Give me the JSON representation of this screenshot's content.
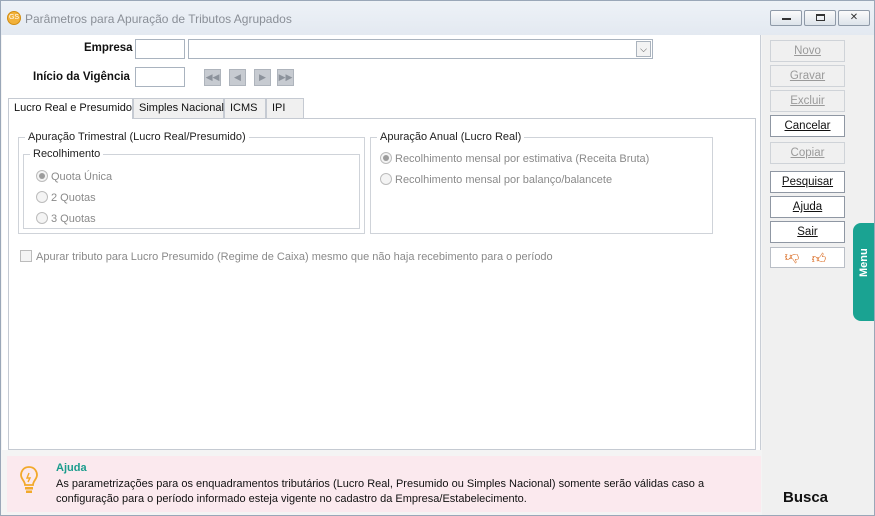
{
  "window": {
    "title": "Parâmetros para Apuração de Tributos Agrupados",
    "app_icon_text": "GS"
  },
  "form": {
    "empresa_label": "Empresa",
    "empresa_code": "",
    "empresa_name": "",
    "vigencia_label": "Início da Vigência",
    "vigencia_value": ""
  },
  "tabs": [
    {
      "label": "Lucro Real e Presumido",
      "active": true
    },
    {
      "label": "Simples Nacional",
      "active": false
    },
    {
      "label": "ICMS",
      "active": false
    },
    {
      "label": "IPI",
      "active": false
    }
  ],
  "trimestral": {
    "legend": "Apuração Trimestral (Lucro Real/Presumido)",
    "recolhimento_legend": "Recolhimento",
    "options": [
      "Quota Única",
      "2 Quotas",
      "3 Quotas"
    ],
    "selected": "Quota Única"
  },
  "anual": {
    "legend": "Apuração Anual (Lucro Real)",
    "options": [
      "Recolhimento mensal por estimativa (Receita Bruta)",
      "Recolhimento mensal por balanço/balancete"
    ],
    "selected": "Recolhimento mensal por estimativa (Receita Bruta)"
  },
  "caixa_checkbox": {
    "label": "Apurar tributo para Lucro Presumido (Regime de Caixa) mesmo que não haja recebimento para o período",
    "checked": false
  },
  "sidebar": {
    "buttons": [
      {
        "label": "Novo",
        "enabled": false
      },
      {
        "label": "Gravar",
        "enabled": false
      },
      {
        "label": "Excluir",
        "enabled": false
      },
      {
        "label": "Cancelar",
        "enabled": true
      },
      {
        "label": "Copiar",
        "enabled": false
      },
      {
        "label": "Pesquisar",
        "enabled": true
      },
      {
        "label": "Ajuda",
        "enabled": true
      },
      {
        "label": "Sair",
        "enabled": true
      }
    ],
    "menu_label": "Menu",
    "busca_label": "Busca"
  },
  "help": {
    "title": "Ajuda",
    "text": "As parametrizações para os enquadramentos tributários (Lucro Real, Presumido ou Simples Nacional) somente serão válidas caso a configuração para o período informado esteja vigente no cadastro da Empresa/Estabelecimento."
  },
  "colors": {
    "accent": "#1aa392",
    "help_background": "#fbe9ee",
    "help_title": "#1a9c8c"
  },
  "icons": [
    "app-logo-icon",
    "minimize-icon",
    "maximize-icon",
    "close-icon",
    "chevron-down-icon",
    "first-record-icon",
    "previous-record-icon",
    "next-record-icon",
    "last-record-icon",
    "thumbs-down-icon",
    "thumbs-up-icon",
    "lightbulb-icon"
  ]
}
